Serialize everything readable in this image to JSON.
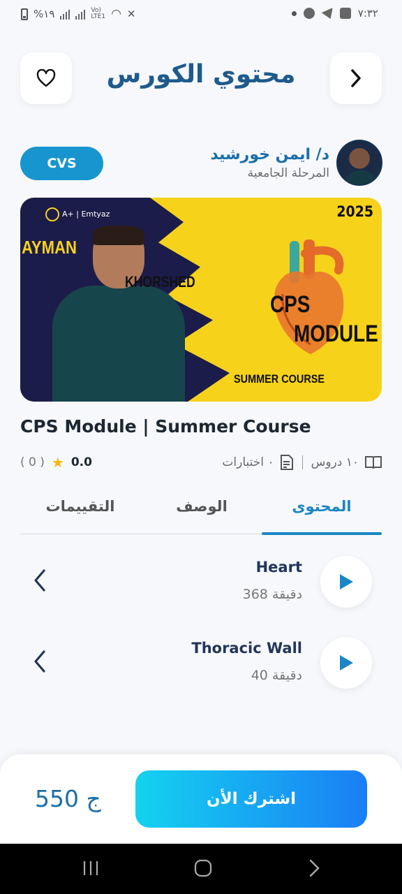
{
  "status_bar": {
    "time": "٧:٣٢",
    "battery": "%١٩"
  },
  "header": {
    "title": "محتوي الكورس",
    "favorite_icon": "heart-icon",
    "back_icon": "chevron-right-icon"
  },
  "instructor": {
    "name": "د/ ايمن خورشيد",
    "stage": "المرحلة الجامعية"
  },
  "category_badge": "CVS",
  "banner": {
    "brand": "A+ | Emtyaz",
    "year": "2025",
    "first_name": "AYMAN",
    "last_name": "KHORSHED",
    "title_line1": "CPS",
    "title_line2": "MODULE",
    "subtitle": "SUMMER COURSE"
  },
  "course": {
    "title": "CPS Module | Summer Course",
    "rating_value": "0.0",
    "rating_count": "( 0 )",
    "lessons_count": "١٠ دروس",
    "exams_count": "٠ اختبارات"
  },
  "tabs": [
    {
      "label": "المحتوى",
      "active": true
    },
    {
      "label": "الوصف",
      "active": false
    },
    {
      "label": "التقييمات",
      "active": false
    }
  ],
  "lessons": [
    {
      "name": "Heart",
      "duration": "368 دقيقة"
    },
    {
      "name": "Thoracic Wall",
      "duration": "40 دقيقة"
    }
  ],
  "bottom": {
    "price": "550 ج",
    "subscribe_label": "اشترك الأن"
  },
  "colors": {
    "primary": "#1a86c5",
    "title_blue": "#1f5a8c",
    "badge": "#1795cf",
    "button_gradient_start": "#14d2f0",
    "button_gradient_end": "#1a7ef5",
    "banner_yellow": "#f7d21b",
    "banner_navy": "#1c1c4a"
  }
}
